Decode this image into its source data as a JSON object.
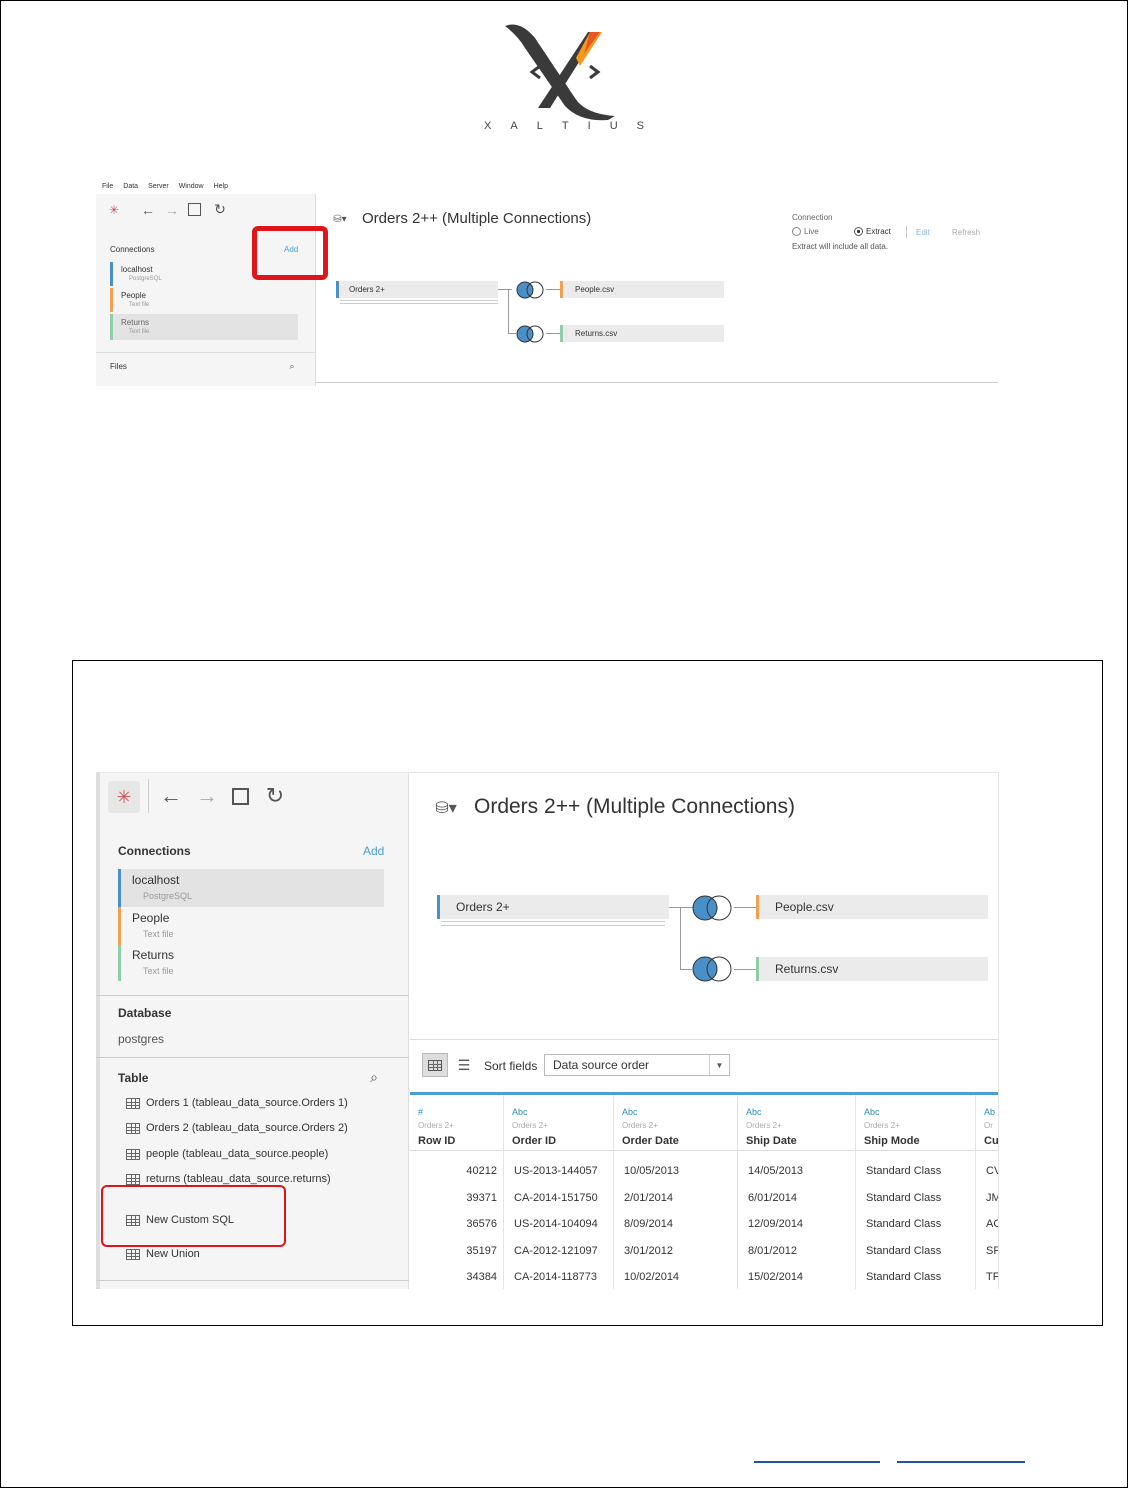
{
  "logo": {
    "wordmark": [
      "X",
      "A",
      "L",
      "T",
      "I",
      "U",
      "S"
    ],
    "brand_colors": {
      "dark": "#3a3a3a",
      "orange": "#f59a1c",
      "red": "#e64a22"
    }
  },
  "shot1": {
    "menu": [
      "File",
      "Data",
      "Server",
      "Window",
      "Help"
    ],
    "connections_label": "Connections",
    "add_label": "Add",
    "connections": [
      {
        "name": "localhost",
        "type": "PostgreSQL",
        "color": "#4a90c8"
      },
      {
        "name": "People",
        "type": "Text file",
        "color": "#f0a050"
      },
      {
        "name": "Returns",
        "type": "Text file",
        "color": "#8fcfa8"
      }
    ],
    "files_label": "Files",
    "title": "Orders 2++ (Multiple Connections)",
    "nodes": {
      "left": "Orders 2+",
      "right1": "People.csv",
      "right2": "Returns.csv"
    },
    "connection_panel": {
      "label": "Connection",
      "live": "Live",
      "extract": "Extract",
      "edit": "Edit",
      "refresh": "Refresh",
      "note": "Extract will include all data."
    }
  },
  "shot2": {
    "connections_label": "Connections",
    "add_label": "Add",
    "connections": [
      {
        "name": "localhost",
        "type": "PostgreSQL",
        "color": "#4a90c8"
      },
      {
        "name": "People",
        "type": "Text file",
        "color": "#f0a050"
      },
      {
        "name": "Returns",
        "type": "Text file",
        "color": "#8fcfa8"
      }
    ],
    "database_label": "Database",
    "database_value": "postgres",
    "table_label": "Table",
    "tables": [
      "Orders 1 (tableau_data_source.Orders 1)",
      "Orders 2 (tableau_data_source.Orders 2)",
      "people (tableau_data_source.people)",
      "returns (tableau_data_source.returns)"
    ],
    "new_custom_sql": "New Custom SQL",
    "new_union": "New Union",
    "title": "Orders 2++ (Multiple Connections)",
    "nodes": {
      "left": "Orders 2+",
      "right1": "People.csv",
      "right2": "Returns.csv"
    },
    "sort_label": "Sort fields",
    "sort_value": "Data source order",
    "columns": [
      {
        "type": "#",
        "source": "Orders 2+",
        "name": "Row ID"
      },
      {
        "type": "Abc",
        "source": "Orders 2+",
        "name": "Order ID"
      },
      {
        "type": "Abc",
        "source": "Orders 2+",
        "name": "Order Date"
      },
      {
        "type": "Abc",
        "source": "Orders 2+",
        "name": "Ship Date"
      },
      {
        "type": "Abc",
        "source": "Orders 2+",
        "name": "Ship Mode"
      },
      {
        "type": "Ab",
        "source": "Or",
        "name": "Cu"
      }
    ],
    "rows": [
      [
        "40212",
        "US-2013-144057",
        "10/05/2013",
        "14/05/2013",
        "Standard Class",
        "CV"
      ],
      [
        "39371",
        "CA-2014-151750",
        "2/01/2014",
        "6/01/2014",
        "Standard Class",
        "JM"
      ],
      [
        "36576",
        "US-2014-104094",
        "8/09/2014",
        "12/09/2014",
        "Standard Class",
        "AC"
      ],
      [
        "35197",
        "CA-2012-121097",
        "3/01/2012",
        "8/01/2012",
        "Standard Class",
        "SF"
      ],
      [
        "34384",
        "CA-2014-118773",
        "10/02/2014",
        "15/02/2014",
        "Standard Class",
        "TF"
      ]
    ]
  }
}
